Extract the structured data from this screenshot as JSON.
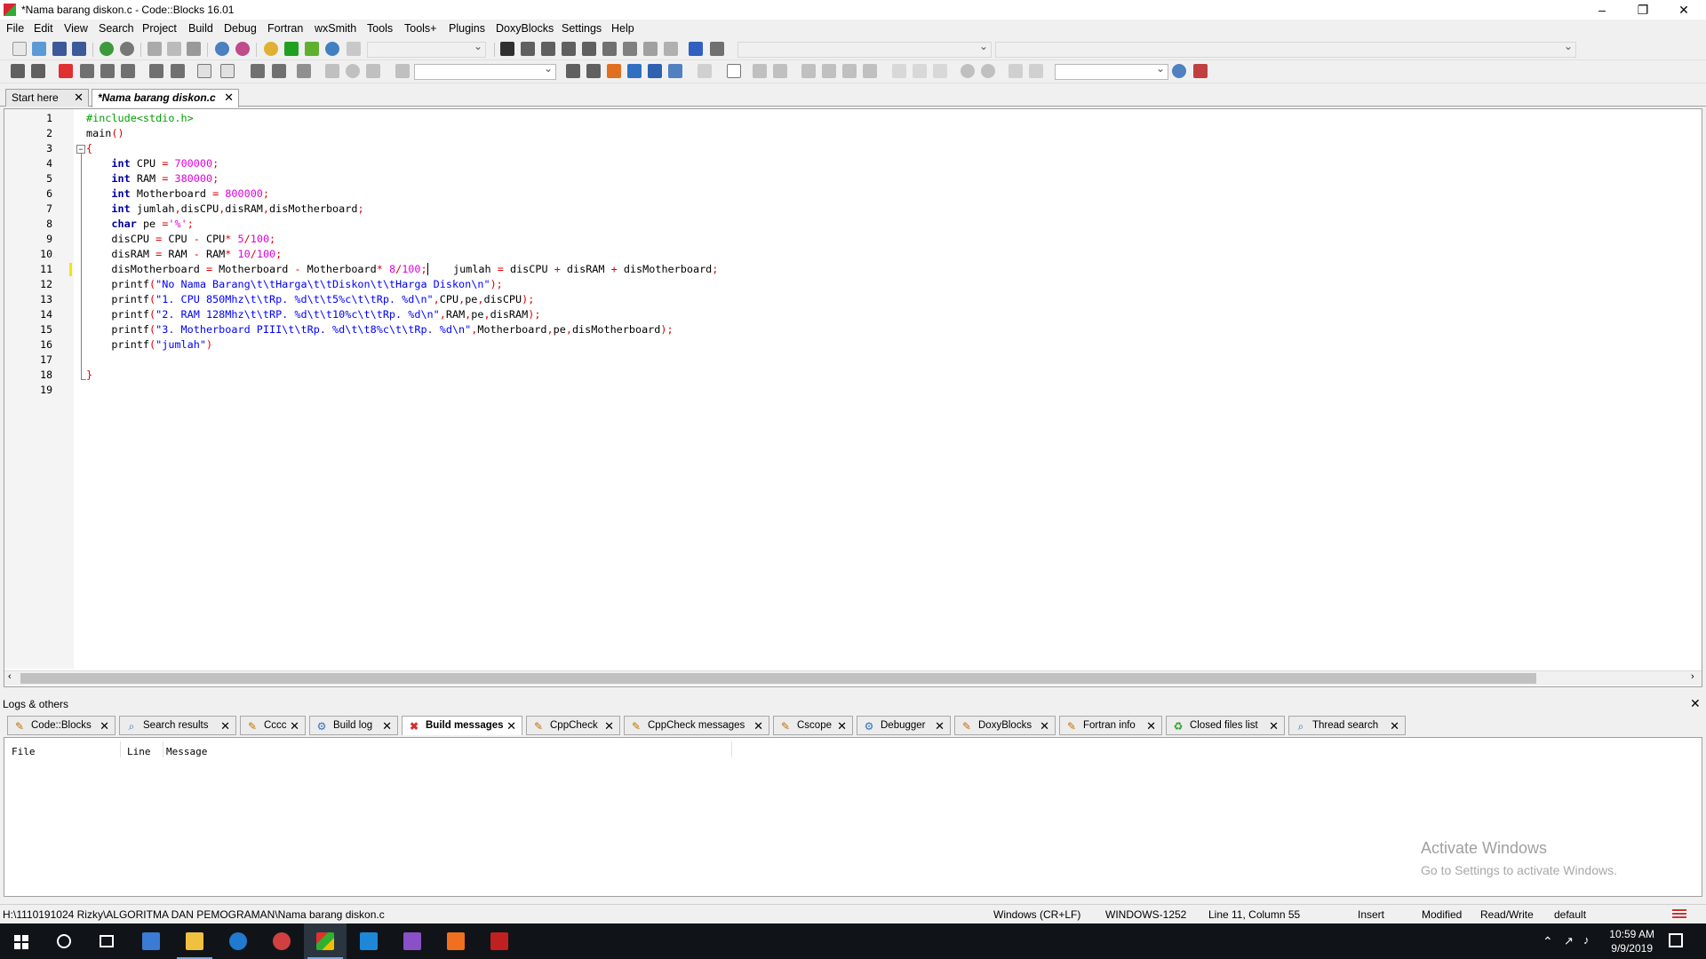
{
  "window": {
    "title": "*Nama barang diskon.c - Code::Blocks 16.01"
  },
  "menu": [
    "File",
    "Edit",
    "View",
    "Search",
    "Project",
    "Build",
    "Debug",
    "Fortran",
    "wxSmith",
    "Tools",
    "Tools+",
    "Plugins",
    "DoxyBlocks",
    "Settings",
    "Help"
  ],
  "editor_tabs": [
    {
      "label": "Start here",
      "active": false
    },
    {
      "label": "*Nama barang diskon.c",
      "active": true
    }
  ],
  "code": {
    "line_numbers": [
      "1",
      "2",
      "3",
      "4",
      "5",
      "6",
      "7",
      "8",
      "9",
      "10",
      "11",
      "12",
      "13",
      "14",
      "15",
      "16",
      "17",
      "18",
      "19"
    ],
    "current_line": 11
  },
  "logs": {
    "title": "Logs & others",
    "tabs": [
      {
        "label": "Code::Blocks",
        "icon": "document-pencil-icon",
        "active": false
      },
      {
        "label": "Search results",
        "icon": "magnifier-icon",
        "active": false
      },
      {
        "label": "Cccc",
        "icon": "document-pencil-icon",
        "active": false
      },
      {
        "label": "Build log",
        "icon": "gear-icon",
        "active": false
      },
      {
        "label": "Build messages",
        "icon": "pin-icon",
        "active": true
      },
      {
        "label": "CppCheck",
        "icon": "document-pencil-icon",
        "active": false
      },
      {
        "label": "CppCheck messages",
        "icon": "document-pencil-icon",
        "active": false
      },
      {
        "label": "Cscope",
        "icon": "document-pencil-icon",
        "active": false
      },
      {
        "label": "Debugger",
        "icon": "gear-icon",
        "active": false
      },
      {
        "label": "DoxyBlocks",
        "icon": "document-pencil-icon",
        "active": false
      },
      {
        "label": "Fortran info",
        "icon": "document-pencil-icon",
        "active": false
      },
      {
        "label": "Closed files list",
        "icon": "recycle-icon",
        "active": false
      },
      {
        "label": "Thread search",
        "icon": "magnifier-icon",
        "active": false
      }
    ],
    "columns": [
      "File",
      "Line",
      "Message"
    ]
  },
  "watermark": {
    "line1": "Activate Windows",
    "line2": "Go to Settings to activate Windows."
  },
  "status": {
    "path": "H:\\1110191024 Rizky\\ALGORITMA DAN PEMOGRAMAN\\Nama barang diskon.c",
    "eol": "Windows (CR+LF)",
    "encoding": "WINDOWS-1252",
    "position": "Line 11, Column 55",
    "mode": "Insert",
    "modified": "Modified",
    "access": "Read/Write",
    "profile": "default"
  },
  "taskbar": {
    "time": "10:59 AM",
    "date": "9/9/2019"
  },
  "colors": {
    "keyword": "#0000a0",
    "number": "#e000e0",
    "string": "#0000ff",
    "preprocessor": "#00a000",
    "operator": "#e00000"
  }
}
